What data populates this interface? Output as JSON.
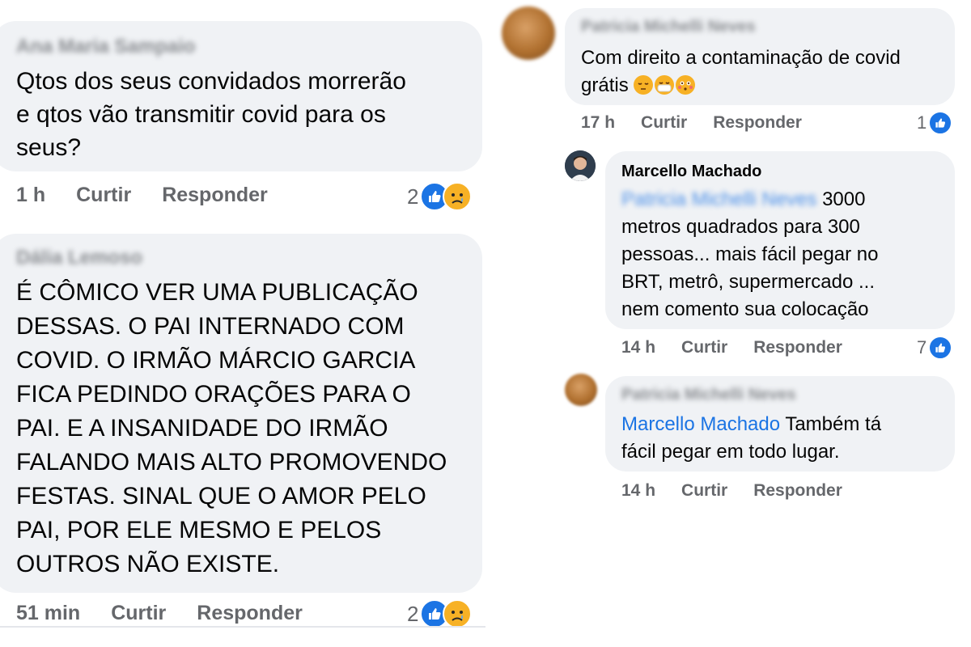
{
  "left": {
    "comment1": {
      "author": "Ana Maria Sampaio",
      "text": "Qtos dos seus convidados morrerão\ne qtos vão transmitir covid para os\nseus?",
      "time": "1 h",
      "like": "Curtir",
      "reply": "Responder",
      "reaction_count": "2",
      "reactions": [
        "like-icon",
        "sad-icon"
      ]
    },
    "comment2": {
      "author": "Dália Lemoso",
      "text": "É CÔMICO VER UMA PUBLICAÇÃO\nDESSAS. O PAI INTERNADO COM\nCOVID. O IRMÃO MÁRCIO GARCIA\nFICA PEDINDO ORAÇÕES PARA O\nPAI. E A INSANIDADE DO IRMÃO\nFALANDO MAIS ALTO PROMOVENDO\nFESTAS. SINAL QUE O AMOR PELO\nPAI, POR ELE MESMO E PELOS\nOUTROS NÃO EXISTE.",
      "time": "51 min",
      "like": "Curtir",
      "reply": "Responder",
      "reaction_count": "2",
      "reactions": [
        "like-icon",
        "sad-icon"
      ]
    }
  },
  "right": {
    "comment1": {
      "author": "Patricia Michelli Neves",
      "text": "Com direito a contaminação de covid\ngrátis",
      "emojis": [
        "relieved-face-icon",
        "mask-face-icon",
        "flushed-face-icon"
      ],
      "time": "17 h",
      "like": "Curtir",
      "reply": "Responder",
      "reaction_count": "1",
      "reactions": [
        "like-icon"
      ]
    },
    "reply1": {
      "author": "Marcello Machado",
      "mention": "Patricia Michelli Neves",
      "text_first": " 3000",
      "text_rest": "metros quadrados para 300\npessoas... mais fácil pegar no\nBRT, metrô, supermercado ...\nnem comento sua colocação",
      "time": "14 h",
      "like": "Curtir",
      "reply": "Responder",
      "reaction_count": "7",
      "reactions": [
        "like-icon"
      ]
    },
    "reply2": {
      "author": "Patricia Michelli Neves",
      "mention": "Marcello Machado",
      "text_first": " Também tá",
      "text_rest": "fácil pegar em todo lugar.",
      "time": "14 h",
      "like": "Curtir",
      "reply": "Responder"
    }
  },
  "colors": {
    "bubble": "#f0f2f5",
    "like_blue": "#1b74e4",
    "meta_gray": "#65676b",
    "sad_yellow": "#f7b125"
  }
}
